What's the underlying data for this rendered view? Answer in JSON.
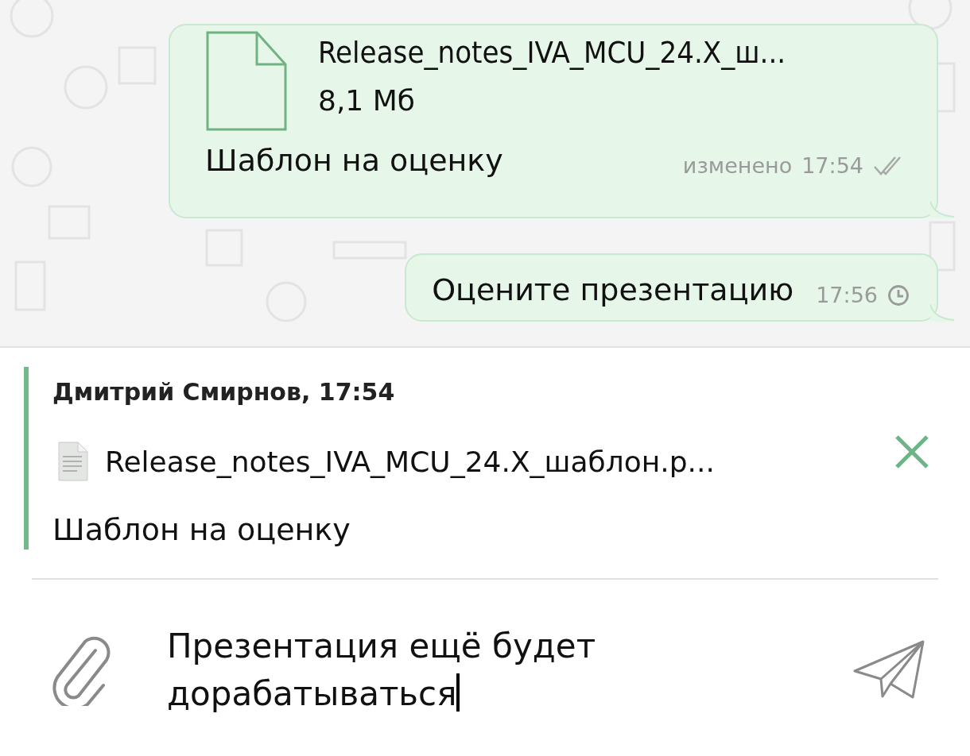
{
  "messages": [
    {
      "kind": "file",
      "file_name": "Release_notes_IVA_MCU_24.X_ш...",
      "file_size": "8,1 Мб",
      "text": "Шаблон на оценку",
      "edited_label": "изменено",
      "time": "17:54",
      "pending": false,
      "read": true
    },
    {
      "kind": "text",
      "text": "Оцените презентацию",
      "time": "17:56",
      "pending": true
    }
  ],
  "reply": {
    "author": "Дмитрий Смирнов, 17:54",
    "file_name": "Release_notes_IVA_MCU_24.X_шаблон.p...",
    "text": "Шаблон на оценку"
  },
  "composer": {
    "value": "Презентация ещё будет дорабатываться",
    "focused": true
  }
}
